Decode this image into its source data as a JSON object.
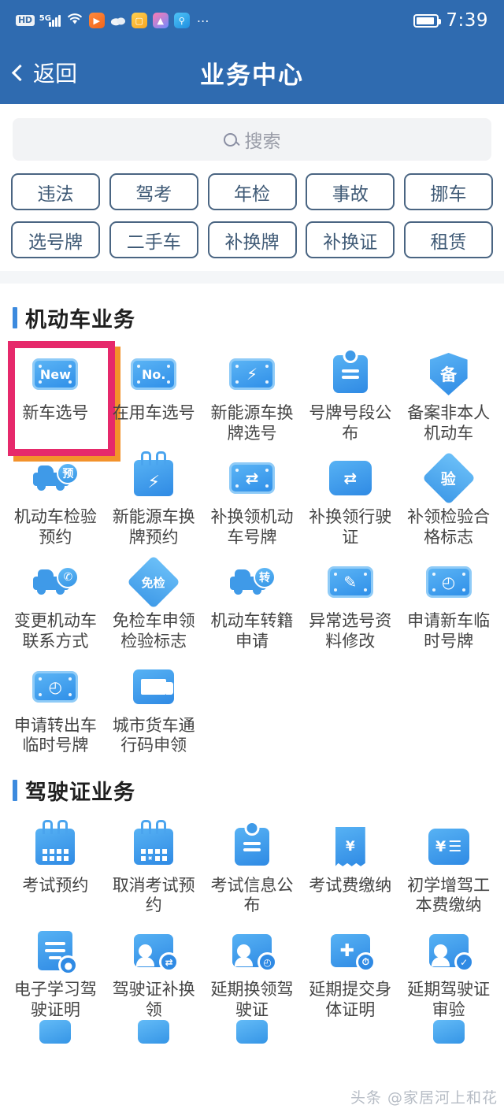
{
  "statusbar": {
    "hd_label": "HD",
    "network_label": "5G",
    "time": "7:39",
    "icons": [
      "hd-badge-icon",
      "signal-bars-icon",
      "wifi-icon",
      "play-app-icon",
      "cloud-icon",
      "orange-app-icon",
      "pink-app-icon",
      "search-app-icon",
      "more-dots-icon"
    ],
    "more": "⋯"
  },
  "navbar": {
    "back_label": "返回",
    "title": "业务中心"
  },
  "search": {
    "placeholder": "搜索"
  },
  "chips": {
    "row1": [
      "违法",
      "驾考",
      "年检",
      "事故",
      "挪车"
    ],
    "row2": [
      "选号牌",
      "二手车",
      "补换牌",
      "补换证",
      "租赁"
    ]
  },
  "colors": {
    "header_blue": "#2f6bb0",
    "icon_blue": "#2f8ae4",
    "accent_blue": "#3c8ade",
    "highlight_pink": "#e6296b",
    "highlight_orange": "#f3922b",
    "chip_border": "#4a6582"
  },
  "sections": [
    {
      "title": "机动车业务",
      "items": [
        {
          "label": "新车选号",
          "icon": "license-plate-new-icon",
          "glyph": "New",
          "highlighted": true
        },
        {
          "label": "在用车选号",
          "icon": "license-plate-no-icon",
          "glyph": "No.",
          "highlighted": false
        },
        {
          "label": "新能源车换牌选号",
          "icon": "license-plate-lightning-icon",
          "glyph": "⚡",
          "highlighted": false
        },
        {
          "label": "号牌号段公布",
          "icon": "clipboard-icon",
          "glyph": "",
          "highlighted": false
        },
        {
          "label": "备案非本人机动车",
          "icon": "shield-bei-icon",
          "glyph": "备",
          "highlighted": false
        },
        {
          "label": "机动车检验预约",
          "icon": "car-appointment-icon",
          "glyph": "预",
          "highlighted": false
        },
        {
          "label": "新能源车换牌预约",
          "icon": "calendar-lightning-icon",
          "glyph": "⚡",
          "highlighted": false
        },
        {
          "label": "补换领机动车号牌",
          "icon": "plate-exchange-icon",
          "glyph": "⇄",
          "highlighted": false
        },
        {
          "label": "补换领行驶证",
          "icon": "car-exchange-icon",
          "glyph": "⇄",
          "highlighted": false
        },
        {
          "label": "补领检验合格标志",
          "icon": "diamond-yan-icon",
          "glyph": "验",
          "highlighted": false
        },
        {
          "label": "变更机动车联系方式",
          "icon": "car-phone-icon",
          "glyph": "✆",
          "highlighted": false
        },
        {
          "label": "免检车申领检验标志",
          "icon": "diamond-mianjian-icon",
          "glyph": "免检",
          "highlighted": false
        },
        {
          "label": "机动车转籍申请",
          "icon": "car-transfer-icon",
          "glyph": "转",
          "highlighted": false
        },
        {
          "label": "异常选号资料修改",
          "icon": "plate-edit-icon",
          "glyph": "✎",
          "highlighted": false
        },
        {
          "label": "申请新车临时号牌",
          "icon": "plate-clock-icon",
          "glyph": "◴",
          "highlighted": false
        },
        {
          "label": "申请转出车临时号牌",
          "icon": "plate-clock-arrow-icon",
          "glyph": "◴",
          "highlighted": false
        },
        {
          "label": "城市货车通行码申领",
          "icon": "truck-pass-icon",
          "glyph": "",
          "highlighted": false
        }
      ]
    },
    {
      "title": "驾驶证业务",
      "items": [
        {
          "label": "考试预约",
          "icon": "calendar-icon",
          "glyph": "",
          "highlighted": false
        },
        {
          "label": "取消考试预约",
          "icon": "calendar-cancel-icon",
          "glyph": "",
          "highlighted": false
        },
        {
          "label": "考试信息公布",
          "icon": "clipboard-check-icon",
          "glyph": "",
          "highlighted": false
        },
        {
          "label": "考试费缴纳",
          "icon": "receipt-yuan-edit-icon",
          "glyph": "¥",
          "highlighted": false
        },
        {
          "label": "初学增驾工本费缴纳",
          "icon": "receipt-yuan-list-icon",
          "glyph": "¥",
          "highlighted": false
        },
        {
          "label": "电子学习驾驶证明",
          "icon": "document-person-icon",
          "glyph": "",
          "highlighted": false
        },
        {
          "label": "驾驶证补换领",
          "icon": "person-exchange-icon",
          "glyph": "⇄",
          "highlighted": false
        },
        {
          "label": "延期换领驾驶证",
          "icon": "person-clock-icon",
          "glyph": "◴",
          "highlighted": false
        },
        {
          "label": "延期提交身体证明",
          "icon": "medical-clock-icon",
          "glyph": "✚",
          "highlighted": false
        },
        {
          "label": "延期驾驶证审验",
          "icon": "person-check-icon",
          "glyph": "✓",
          "highlighted": false
        }
      ]
    }
  ],
  "watermark": "头条 @家居河上和花"
}
